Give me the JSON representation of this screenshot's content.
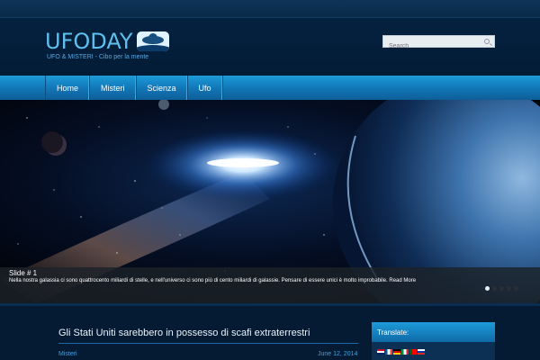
{
  "header": {
    "logo_text": "UFODAY",
    "tagline": "UFO & MISTERI - Cibo per la mente"
  },
  "search": {
    "placeholder": "Search"
  },
  "nav": {
    "items": [
      {
        "label": "Home"
      },
      {
        "label": "Misteri"
      },
      {
        "label": "Scienza"
      },
      {
        "label": "Ufo"
      }
    ]
  },
  "slider": {
    "caption_title": "Slide # 1",
    "caption_text": "Nella nostra galassia ci sono quattrocento miliardi di stelle, e nell'universo ci sono più di cento miliardi di galassie. Pensare di essere unici è molto improbabile.",
    "read_more": "Read More",
    "slide_count": 5,
    "active_index": 0
  },
  "post": {
    "title": "Gli Stati Uniti sarebbero in possesso di scafi extraterrestri",
    "category": "Misteri",
    "date": "June 12, 2014"
  },
  "sidebar": {
    "translate_title": "Translate:",
    "flags": [
      "english-flag-icon",
      "french-flag-icon",
      "german-flag-icon",
      "italian-flag-icon",
      "portuguese-flag-icon",
      "russian-flag-icon"
    ]
  },
  "colors": {
    "accent": "#1d9bd9",
    "background": "#031a33",
    "link": "#3da2e3"
  }
}
